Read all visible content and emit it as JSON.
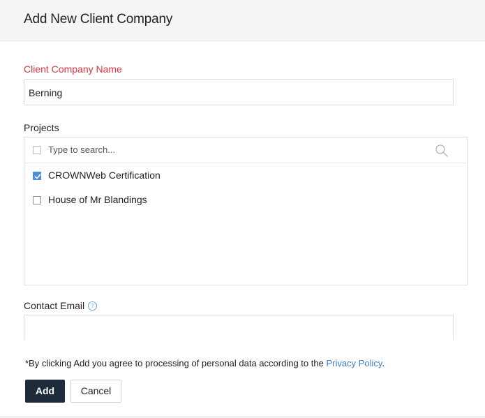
{
  "dialog": {
    "title": "Add New Client Company"
  },
  "company_name": {
    "label": "Client Company Name",
    "value": "Berning"
  },
  "projects": {
    "label": "Projects",
    "search_placeholder": "Type to search...",
    "select_all_checked": false,
    "items": [
      {
        "label": "CROWNWeb Certification",
        "checked": true
      },
      {
        "label": "House of Mr Blandings",
        "checked": false
      }
    ]
  },
  "contact_email": {
    "label": "Contact Email",
    "help_icon": "question-circle-icon",
    "value": ""
  },
  "consent": {
    "text": "*By clicking Add you agree to processing of personal data according to the ",
    "link_text": "Privacy Policy",
    "suffix": "."
  },
  "actions": {
    "add_label": "Add",
    "cancel_label": "Cancel"
  },
  "colors": {
    "required_label": "#d9363e",
    "link": "#3d7fc4",
    "checkbox_checked": "#4a90d9",
    "primary_button": "#1f2a3a"
  }
}
